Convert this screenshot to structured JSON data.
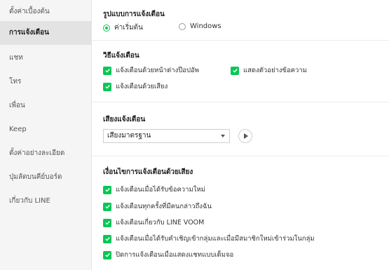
{
  "sidebar": {
    "items": [
      {
        "label": "ตั้งค่าเบื้องต้น"
      },
      {
        "label": "การแจ้งเตือน"
      },
      {
        "label": "แชท"
      },
      {
        "label": "โทร"
      },
      {
        "label": "เพื่อน"
      },
      {
        "label": "Keep"
      },
      {
        "label": "ตั้งค่าอย่างละเอียด"
      },
      {
        "label": "ปุ่มลัดบนคีย์บอร์ด"
      },
      {
        "label": "เกี่ยวกับ LINE"
      }
    ]
  },
  "format": {
    "title": "รูปแบบการแจ้งเตือน",
    "options": [
      "ค่าเริ่มต้น",
      "Windows"
    ],
    "selected": "ค่าเริ่มต้น"
  },
  "method": {
    "title": "วิธีแจ้งเตือน",
    "options": [
      "แจ้งเตือนด้วยหน้าต่างป๊อปอัพ",
      "แสดงตัวอย่างข้อความ",
      "แจ้งเตือนด้วยเสียง"
    ]
  },
  "sound": {
    "title": "เสียงแจ้งเตือน",
    "selected": "เสียงมาตรฐาน"
  },
  "conditions": {
    "title": "เงื่อนไขการแจ้งเตือนด้วยเสียง",
    "options": [
      "แจ้งเตือนเมื่อได้รับข้อความใหม่",
      "แจ้งเตือนทุกครั้งที่มีคนกล่าวถึงฉัน",
      "แจ้งเตือนเกี่ยวกับ LINE VOOM",
      "แจ้งเตือนเมื่อได้รับคำเชิญเข้ากลุ่มและเมื่อมีสมาชิกใหม่เข้าร่วมในกลุ่ม",
      "ปิดการแจ้งเตือนเมื่อแสดงแชทแบบเต็มจอ"
    ]
  },
  "colors": {
    "accent": "#06c755",
    "sidebar_bg": "#f5f5f5",
    "active_bg": "#e3e3e3"
  }
}
